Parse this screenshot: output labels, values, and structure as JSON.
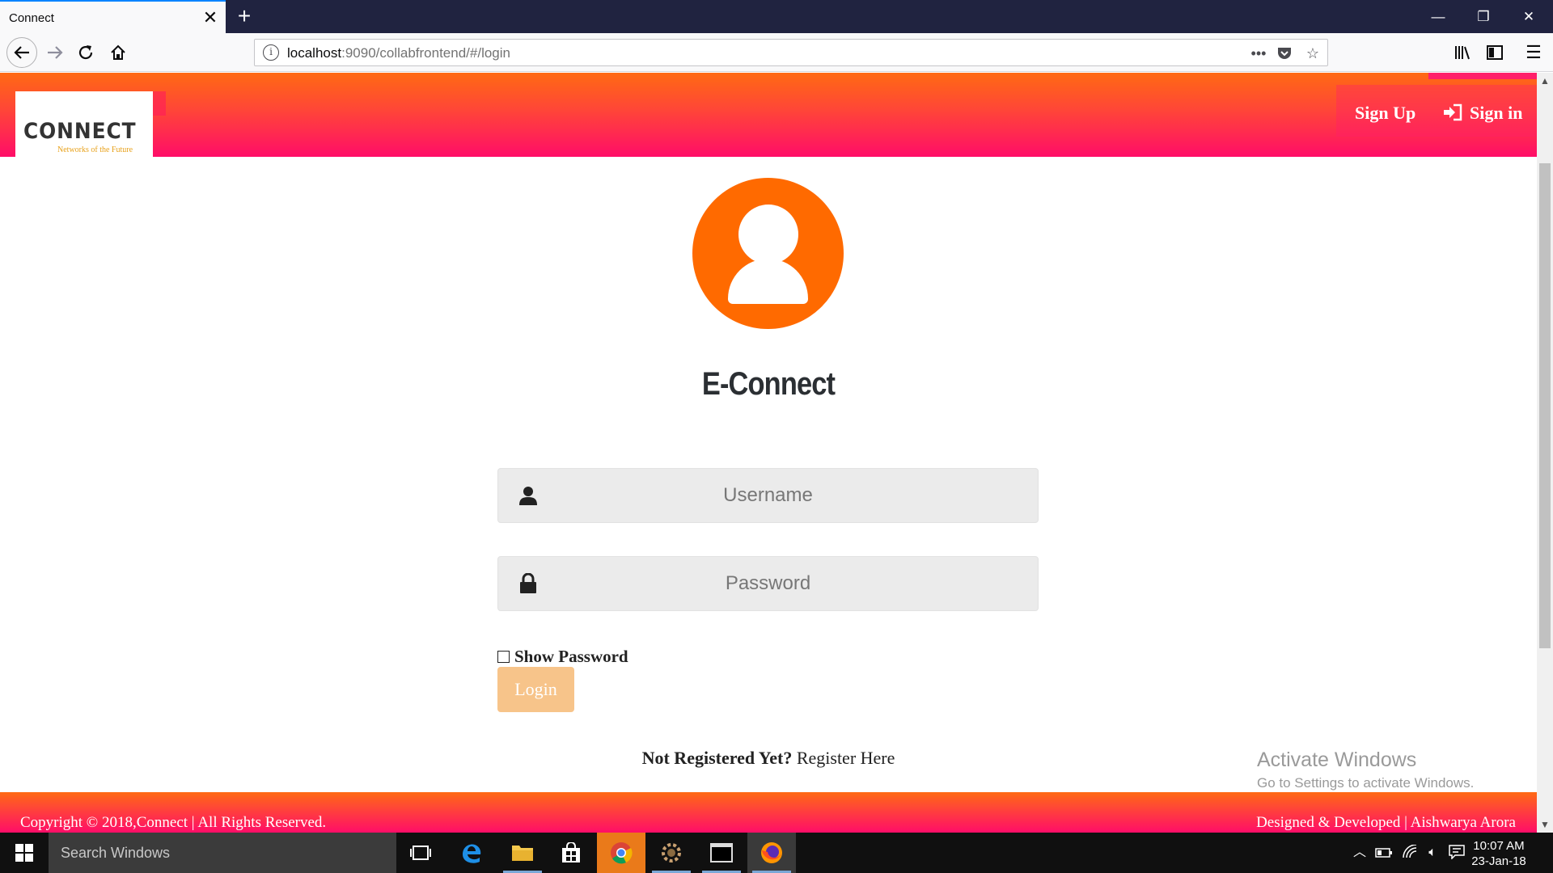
{
  "browser": {
    "tab_title": "Connect",
    "url_host": "localhost",
    "url_path": ":9090/collabfrontend/#/login"
  },
  "header": {
    "logo_text": "CONNECT",
    "logo_tagline": "Networks of the Future",
    "signup_label": "Sign Up",
    "signin_label": "Sign in"
  },
  "login": {
    "app_title": "E-Connect",
    "username_placeholder": "Username",
    "password_placeholder": "Password",
    "show_password_label": "Show Password",
    "login_button": "Login",
    "not_registered": "Not Registered Yet?",
    "register_link": "Register Here"
  },
  "watermark": {
    "title": "Activate Windows",
    "subtitle": "Go to Settings to activate Windows."
  },
  "footer": {
    "copyright": "Copyright © 2018,Connect | All Rights Reserved.",
    "credits": "Designed & Developed | Aishwarya Arora"
  },
  "taskbar": {
    "search_placeholder": "Search Windows",
    "time": "10:07 AM",
    "date": "23-Jan-18"
  },
  "colors": {
    "brand_orange": "#ff6a00",
    "header_gradient_top": "#ff6a13",
    "header_gradient_bottom": "#ff0d68",
    "login_button": "#f7c48a"
  }
}
